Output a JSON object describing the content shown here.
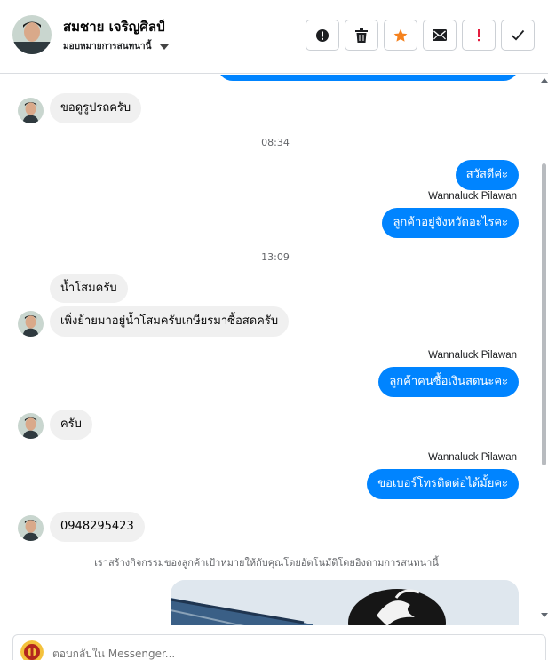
{
  "header": {
    "name": "สมชาย เจริญศิลป์",
    "assign": "มอบหมายการสนทนานี้"
  },
  "toolbar": [
    {
      "name": "report-button",
      "icon": "alert-circle-icon"
    },
    {
      "name": "delete-button",
      "icon": "trash-icon"
    },
    {
      "name": "star-button",
      "icon": "star-icon"
    },
    {
      "name": "mark-unread-button",
      "icon": "envelope-icon"
    },
    {
      "name": "follow-up-button",
      "icon": "exclamation-icon"
    },
    {
      "name": "mark-done-button",
      "icon": "checkmark-icon"
    }
  ],
  "thread": {
    "m1": "ขอดูรูปรถครับ",
    "ts1": "08:34",
    "m2": "สวัสดีค่ะ",
    "sender1": "Wannaluck Pilawan",
    "m3": "ลูกค้าอยู่จังหวัดอะไรคะ",
    "ts2": "13:09",
    "m4": "น้ำโสมครับ",
    "m5": "เพิ่งย้ายมาอยู่น้ำโสมครับเกษียรมาซื้อสดครับ",
    "sender2": "Wannaluck Pilawan",
    "m6": "ลูกค้าคนซื้อเงินสดนะคะ",
    "m7": "ครับ",
    "sender3": "Wannaluck Pilawan",
    "m8": "ขอเบอร์โทรติดต่อได้มั้ยคะ",
    "m9": "0948295423",
    "system_note": "เราสร้างกิจกรรมของลูกค้าเป้าหมายให้กับคุณโดยอัตโนมัติโดยอิงตามการสนทนานี้"
  },
  "composer": {
    "placeholder": "ตอบกลับใน Messenger..."
  },
  "colors": {
    "outgoing": "#0084ff",
    "incoming": "#f0f0f0",
    "star": "#f5821f",
    "follow_up": "#e41e3f"
  }
}
